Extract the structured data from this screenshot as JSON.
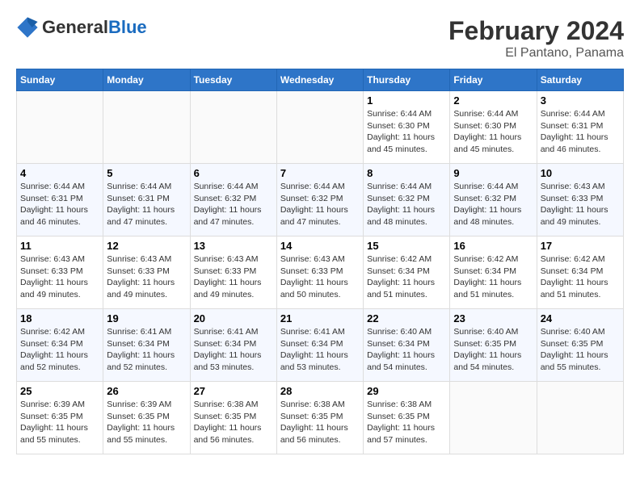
{
  "header": {
    "logo_general": "General",
    "logo_blue": "Blue",
    "title": "February 2024",
    "subtitle": "El Pantano, Panama"
  },
  "weekdays": [
    "Sunday",
    "Monday",
    "Tuesday",
    "Wednesday",
    "Thursday",
    "Friday",
    "Saturday"
  ],
  "weeks": [
    [
      {
        "day": "",
        "info": ""
      },
      {
        "day": "",
        "info": ""
      },
      {
        "day": "",
        "info": ""
      },
      {
        "day": "",
        "info": ""
      },
      {
        "day": "1",
        "info": "Sunrise: 6:44 AM\nSunset: 6:30 PM\nDaylight: 11 hours\nand 45 minutes."
      },
      {
        "day": "2",
        "info": "Sunrise: 6:44 AM\nSunset: 6:30 PM\nDaylight: 11 hours\nand 45 minutes."
      },
      {
        "day": "3",
        "info": "Sunrise: 6:44 AM\nSunset: 6:31 PM\nDaylight: 11 hours\nand 46 minutes."
      }
    ],
    [
      {
        "day": "4",
        "info": "Sunrise: 6:44 AM\nSunset: 6:31 PM\nDaylight: 11 hours\nand 46 minutes."
      },
      {
        "day": "5",
        "info": "Sunrise: 6:44 AM\nSunset: 6:31 PM\nDaylight: 11 hours\nand 47 minutes."
      },
      {
        "day": "6",
        "info": "Sunrise: 6:44 AM\nSunset: 6:32 PM\nDaylight: 11 hours\nand 47 minutes."
      },
      {
        "day": "7",
        "info": "Sunrise: 6:44 AM\nSunset: 6:32 PM\nDaylight: 11 hours\nand 47 minutes."
      },
      {
        "day": "8",
        "info": "Sunrise: 6:44 AM\nSunset: 6:32 PM\nDaylight: 11 hours\nand 48 minutes."
      },
      {
        "day": "9",
        "info": "Sunrise: 6:44 AM\nSunset: 6:32 PM\nDaylight: 11 hours\nand 48 minutes."
      },
      {
        "day": "10",
        "info": "Sunrise: 6:43 AM\nSunset: 6:33 PM\nDaylight: 11 hours\nand 49 minutes."
      }
    ],
    [
      {
        "day": "11",
        "info": "Sunrise: 6:43 AM\nSunset: 6:33 PM\nDaylight: 11 hours\nand 49 minutes."
      },
      {
        "day": "12",
        "info": "Sunrise: 6:43 AM\nSunset: 6:33 PM\nDaylight: 11 hours\nand 49 minutes."
      },
      {
        "day": "13",
        "info": "Sunrise: 6:43 AM\nSunset: 6:33 PM\nDaylight: 11 hours\nand 49 minutes."
      },
      {
        "day": "14",
        "info": "Sunrise: 6:43 AM\nSunset: 6:33 PM\nDaylight: 11 hours\nand 50 minutes."
      },
      {
        "day": "15",
        "info": "Sunrise: 6:42 AM\nSunset: 6:34 PM\nDaylight: 11 hours\nand 51 minutes."
      },
      {
        "day": "16",
        "info": "Sunrise: 6:42 AM\nSunset: 6:34 PM\nDaylight: 11 hours\nand 51 minutes."
      },
      {
        "day": "17",
        "info": "Sunrise: 6:42 AM\nSunset: 6:34 PM\nDaylight: 11 hours\nand 51 minutes."
      }
    ],
    [
      {
        "day": "18",
        "info": "Sunrise: 6:42 AM\nSunset: 6:34 PM\nDaylight: 11 hours\nand 52 minutes."
      },
      {
        "day": "19",
        "info": "Sunrise: 6:41 AM\nSunset: 6:34 PM\nDaylight: 11 hours\nand 52 minutes."
      },
      {
        "day": "20",
        "info": "Sunrise: 6:41 AM\nSunset: 6:34 PM\nDaylight: 11 hours\nand 53 minutes."
      },
      {
        "day": "21",
        "info": "Sunrise: 6:41 AM\nSunset: 6:34 PM\nDaylight: 11 hours\nand 53 minutes."
      },
      {
        "day": "22",
        "info": "Sunrise: 6:40 AM\nSunset: 6:34 PM\nDaylight: 11 hours\nand 54 minutes."
      },
      {
        "day": "23",
        "info": "Sunrise: 6:40 AM\nSunset: 6:35 PM\nDaylight: 11 hours\nand 54 minutes."
      },
      {
        "day": "24",
        "info": "Sunrise: 6:40 AM\nSunset: 6:35 PM\nDaylight: 11 hours\nand 55 minutes."
      }
    ],
    [
      {
        "day": "25",
        "info": "Sunrise: 6:39 AM\nSunset: 6:35 PM\nDaylight: 11 hours\nand 55 minutes."
      },
      {
        "day": "26",
        "info": "Sunrise: 6:39 AM\nSunset: 6:35 PM\nDaylight: 11 hours\nand 55 minutes."
      },
      {
        "day": "27",
        "info": "Sunrise: 6:38 AM\nSunset: 6:35 PM\nDaylight: 11 hours\nand 56 minutes."
      },
      {
        "day": "28",
        "info": "Sunrise: 6:38 AM\nSunset: 6:35 PM\nDaylight: 11 hours\nand 56 minutes."
      },
      {
        "day": "29",
        "info": "Sunrise: 6:38 AM\nSunset: 6:35 PM\nDaylight: 11 hours\nand 57 minutes."
      },
      {
        "day": "",
        "info": ""
      },
      {
        "day": "",
        "info": ""
      }
    ]
  ]
}
